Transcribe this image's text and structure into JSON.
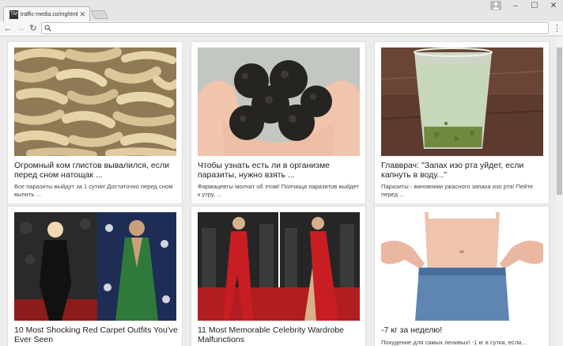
{
  "browser": {
    "tab_title": "traffic-media.co/mghtml",
    "favicon_text": "TM",
    "address": ""
  },
  "cards": [
    {
      "headline": "Огромный ком глистов вывалился, если перед сном натощак ...",
      "desc": "Все паразиты выйдут за 1 сутки! Достаточно перед сном выпить ..."
    },
    {
      "headline": "Чтобы узнать есть ли в организме паразиты, нужно взять ...",
      "desc": "Фармацевты молчат об этом! Полчища паразитов выйдет к утру, ..."
    },
    {
      "headline": "Главврач: \"Запах изо рта уйдет, если капнуть в воду...\"",
      "desc": "Паразиты - виновники ужасного запаха изо рта! Пейте перед ..."
    },
    {
      "headline": "10 Most Shocking Red Carpet Outfits You've Ever Seen",
      "desc": ""
    },
    {
      "headline": "11 Most Memorable Celebrity Wardrobe Malfunctions",
      "desc": ""
    },
    {
      "headline": "-7 кг за неделю!",
      "desc": "Похудение для самых ленивых! -1 кг в сутки, если..."
    }
  ]
}
